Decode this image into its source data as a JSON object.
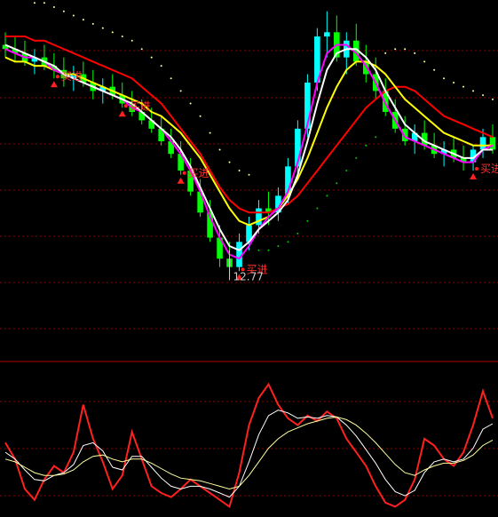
{
  "colors": {
    "background": "#000000",
    "grid": "#8b0000",
    "up_candle": "#00ffff",
    "down_candle": "#00ff00",
    "ma_short": "#ffffff",
    "ma_mid": "#ff00ff",
    "ma_long": "#ffff00",
    "ma_trend": "#ff0000",
    "dots": "#ffffa0",
    "dots_low": "#00cc00",
    "signal": "#ff2020",
    "label": "#ff3030",
    "price_label": "#c8c8c8"
  },
  "chart_data": [
    {
      "type": "candlestick",
      "title": "",
      "ylim": [
        11.0,
        19.2
      ],
      "ohlc": [
        [
          18.3,
          18.6,
          18.0,
          18.2
        ],
        [
          18.2,
          18.5,
          17.9,
          18.1
        ],
        [
          18.1,
          18.4,
          17.8,
          17.9
        ],
        [
          17.9,
          18.2,
          17.6,
          18.0
        ],
        [
          18.0,
          18.3,
          17.7,
          17.8
        ],
        [
          17.8,
          18.1,
          17.5,
          17.7
        ],
        [
          17.7,
          18.0,
          17.3,
          17.5
        ],
        [
          17.5,
          17.8,
          17.2,
          17.6
        ],
        [
          17.6,
          17.9,
          17.3,
          17.4
        ],
        [
          17.4,
          17.7,
          17.0,
          17.2
        ],
        [
          17.2,
          17.5,
          16.9,
          17.3
        ],
        [
          17.3,
          17.6,
          17.0,
          17.1
        ],
        [
          17.1,
          17.4,
          16.8,
          16.9
        ],
        [
          16.9,
          17.2,
          16.6,
          16.7
        ],
        [
          16.7,
          17.0,
          16.4,
          16.5
        ],
        [
          16.5,
          16.8,
          16.2,
          16.3
        ],
        [
          16.3,
          16.6,
          15.9,
          16.0
        ],
        [
          16.0,
          16.3,
          15.6,
          15.7
        ],
        [
          15.7,
          16.0,
          15.2,
          15.3
        ],
        [
          15.3,
          15.6,
          14.7,
          14.8
        ],
        [
          14.8,
          15.1,
          14.2,
          14.3
        ],
        [
          14.3,
          14.6,
          13.6,
          13.7
        ],
        [
          13.7,
          14.0,
          13.0,
          13.2
        ],
        [
          13.2,
          13.6,
          12.77,
          13.0
        ],
        [
          13.0,
          13.8,
          12.9,
          13.6
        ],
        [
          13.6,
          14.2,
          13.4,
          14.0
        ],
        [
          14.0,
          14.6,
          13.8,
          14.4
        ],
        [
          14.4,
          14.8,
          14.0,
          14.3
        ],
        [
          14.3,
          14.9,
          14.1,
          14.7
        ],
        [
          14.7,
          15.6,
          14.5,
          15.4
        ],
        [
          15.4,
          16.5,
          15.2,
          16.3
        ],
        [
          16.3,
          17.6,
          16.1,
          17.4
        ],
        [
          17.4,
          18.7,
          17.2,
          18.5
        ],
        [
          18.5,
          19.1,
          18.0,
          18.6
        ],
        [
          18.6,
          19.0,
          17.9,
          18.0
        ],
        [
          18.0,
          18.6,
          17.6,
          18.4
        ],
        [
          18.4,
          18.8,
          17.8,
          17.9
        ],
        [
          17.9,
          18.3,
          17.4,
          17.6
        ],
        [
          17.6,
          18.0,
          17.0,
          17.2
        ],
        [
          17.2,
          17.5,
          16.6,
          16.7
        ],
        [
          16.7,
          17.0,
          16.2,
          16.3
        ],
        [
          16.3,
          16.6,
          15.9,
          16.0
        ],
        [
          16.0,
          16.4,
          15.7,
          16.2
        ],
        [
          16.2,
          16.5,
          15.8,
          15.9
        ],
        [
          15.9,
          16.2,
          15.6,
          15.7
        ],
        [
          15.7,
          16.0,
          15.4,
          15.8
        ],
        [
          15.8,
          16.1,
          15.5,
          15.6
        ],
        [
          15.6,
          15.9,
          15.3,
          15.5
        ],
        [
          15.5,
          15.9,
          15.3,
          15.8
        ],
        [
          15.8,
          16.3,
          15.6,
          16.1
        ],
        [
          16.1,
          16.4,
          15.7,
          15.8
        ]
      ],
      "ma_short": [
        18.3,
        18.2,
        18.1,
        18.0,
        17.9,
        17.8,
        17.6,
        17.5,
        17.4,
        17.3,
        17.2,
        17.1,
        17.0,
        16.9,
        16.7,
        16.5,
        16.3,
        16.1,
        15.8,
        15.4,
        14.9,
        14.4,
        13.9,
        13.5,
        13.4,
        13.6,
        13.9,
        14.1,
        14.3,
        14.6,
        15.2,
        16.0,
        16.9,
        17.7,
        18.1,
        18.2,
        18.2,
        18.0,
        17.7,
        17.2,
        16.8,
        16.4,
        16.2,
        16.0,
        15.9,
        15.8,
        15.7,
        15.6,
        15.6,
        15.8,
        15.8
      ],
      "ma_mid": [
        18.2,
        18.1,
        18.0,
        18.0,
        17.9,
        17.7,
        17.6,
        17.5,
        17.4,
        17.3,
        17.2,
        17.1,
        17.0,
        16.8,
        16.7,
        16.5,
        16.3,
        16.0,
        15.7,
        15.3,
        14.8,
        14.2,
        13.7,
        13.3,
        13.2,
        13.5,
        13.9,
        14.2,
        14.4,
        14.8,
        15.5,
        16.4,
        17.4,
        18.1,
        18.3,
        18.3,
        18.1,
        17.8,
        17.4,
        16.9,
        16.5,
        16.1,
        16.0,
        15.9,
        15.8,
        15.7,
        15.6,
        15.5,
        15.5,
        15.8,
        15.9
      ],
      "ma_long": [
        18.0,
        17.9,
        17.9,
        17.8,
        17.8,
        17.7,
        17.6,
        17.6,
        17.5,
        17.4,
        17.3,
        17.2,
        17.1,
        17.0,
        16.9,
        16.7,
        16.6,
        16.4,
        16.2,
        15.9,
        15.6,
        15.2,
        14.8,
        14.4,
        14.1,
        14.0,
        14.1,
        14.2,
        14.4,
        14.7,
        15.1,
        15.6,
        16.2,
        16.8,
        17.3,
        17.7,
        17.9,
        17.9,
        17.8,
        17.6,
        17.3,
        17.0,
        16.8,
        16.6,
        16.4,
        16.2,
        16.1,
        16.0,
        15.9,
        15.9,
        15.9
      ],
      "ma_trend": [
        18.5,
        18.5,
        18.5,
        18.4,
        18.4,
        18.3,
        18.2,
        18.1,
        18.0,
        17.9,
        17.8,
        17.7,
        17.6,
        17.5,
        17.3,
        17.1,
        16.9,
        16.6,
        16.3,
        16.0,
        15.7,
        15.3,
        14.9,
        14.6,
        14.4,
        14.3,
        14.3,
        14.3,
        14.4,
        14.5,
        14.7,
        15.0,
        15.3,
        15.6,
        15.9,
        16.2,
        16.5,
        16.8,
        17.0,
        17.2,
        17.3,
        17.3,
        17.2,
        17.0,
        16.8,
        16.6,
        16.5,
        16.4,
        16.3,
        16.2,
        16.1
      ],
      "buy_signals": [
        {
          "index": 5,
          "label": "买进"
        },
        {
          "index": 12,
          "label": "买进"
        },
        {
          "index": 18,
          "label": "买进"
        },
        {
          "index": 24,
          "label": "买进"
        },
        {
          "index": 48,
          "label": "买进"
        }
      ],
      "low_marker": {
        "index": 23,
        "label": "12.77"
      }
    },
    {
      "type": "line",
      "title": "",
      "ylim": [
        0,
        100
      ],
      "series": [
        {
          "color_key": "signal",
          "values": [
            52,
            40,
            18,
            10,
            25,
            35,
            30,
            45,
            80,
            55,
            38,
            18,
            28,
            60,
            40,
            20,
            15,
            12,
            18,
            25,
            20,
            15,
            10,
            5,
            30,
            65,
            85,
            95,
            80,
            70,
            65,
            72,
            68,
            75,
            70,
            55,
            45,
            35,
            20,
            8,
            5,
            10,
            25,
            55,
            50,
            40,
            35,
            45,
            65,
            90,
            70
          ]
        },
        {
          "color_key": "ma_short",
          "values": [
            45,
            40,
            32,
            25,
            24,
            28,
            30,
            36,
            50,
            52,
            46,
            34,
            32,
            42,
            42,
            34,
            26,
            20,
            18,
            20,
            20,
            18,
            15,
            12,
            20,
            38,
            58,
            72,
            76,
            74,
            70,
            71,
            70,
            72,
            71,
            65,
            57,
            47,
            37,
            25,
            16,
            13,
            17,
            30,
            38,
            40,
            38,
            40,
            48,
            62,
            66
          ]
        },
        {
          "color_key": "dots",
          "values": [
            40,
            38,
            34,
            30,
            28,
            28,
            29,
            32,
            38,
            42,
            43,
            40,
            38,
            40,
            40,
            37,
            33,
            29,
            26,
            25,
            24,
            22,
            20,
            18,
            20,
            28,
            38,
            48,
            55,
            60,
            63,
            66,
            68,
            70,
            71,
            69,
            65,
            59,
            52,
            44,
            36,
            30,
            28,
            32,
            35,
            37,
            37,
            39,
            43,
            50,
            54
          ]
        }
      ]
    }
  ]
}
